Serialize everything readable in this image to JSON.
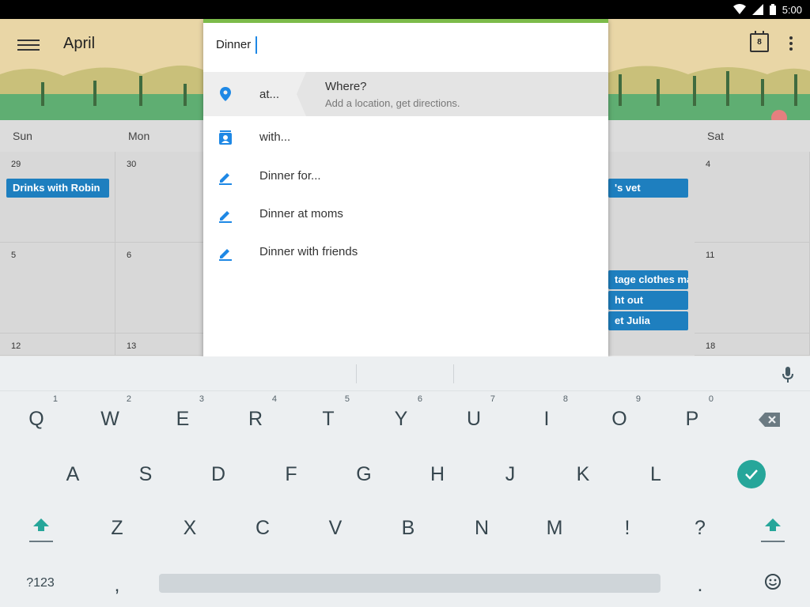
{
  "statusbar": {
    "time": "5:00"
  },
  "calendar": {
    "month": "April",
    "today_day": "8",
    "days_of_week": [
      "Sun",
      "Mon",
      "Sat"
    ],
    "dates": [
      "29",
      "30",
      "4",
      "5",
      "6",
      "11",
      "12",
      "13",
      "18"
    ],
    "events": [
      "Drinks with Robin",
      "'s vet",
      "tage clothes ma",
      "ht out",
      "et Julia"
    ]
  },
  "overlay": {
    "title_value": "Dinner",
    "accent_color": "#7cbb4a",
    "items": [
      {
        "icon": "location-pin-icon",
        "label": "at..."
      },
      {
        "icon": "contact-icon",
        "label": "with..."
      },
      {
        "icon": "pencil-icon",
        "label": "Dinner for..."
      },
      {
        "icon": "pencil-icon",
        "label": "Dinner at moms"
      },
      {
        "icon": "pencil-icon",
        "label": "Dinner with friends"
      }
    ],
    "highlight": {
      "title": "Where?",
      "subtitle": "Add a location, get directions."
    }
  },
  "keyboard": {
    "row1": [
      "Q",
      "W",
      "E",
      "R",
      "T",
      "Y",
      "U",
      "I",
      "O",
      "P"
    ],
    "row1_hints": [
      "1",
      "2",
      "3",
      "4",
      "5",
      "6",
      "7",
      "8",
      "9",
      "0"
    ],
    "row2": [
      "A",
      "S",
      "D",
      "F",
      "G",
      "H",
      "J",
      "K",
      "L"
    ],
    "row3": [
      "Z",
      "X",
      "C",
      "V",
      "B",
      "N",
      "M",
      "!",
      "?"
    ],
    "symbols_label": "?123",
    "comma": ",",
    "period": ".",
    "enter_color": "#26a69a"
  }
}
